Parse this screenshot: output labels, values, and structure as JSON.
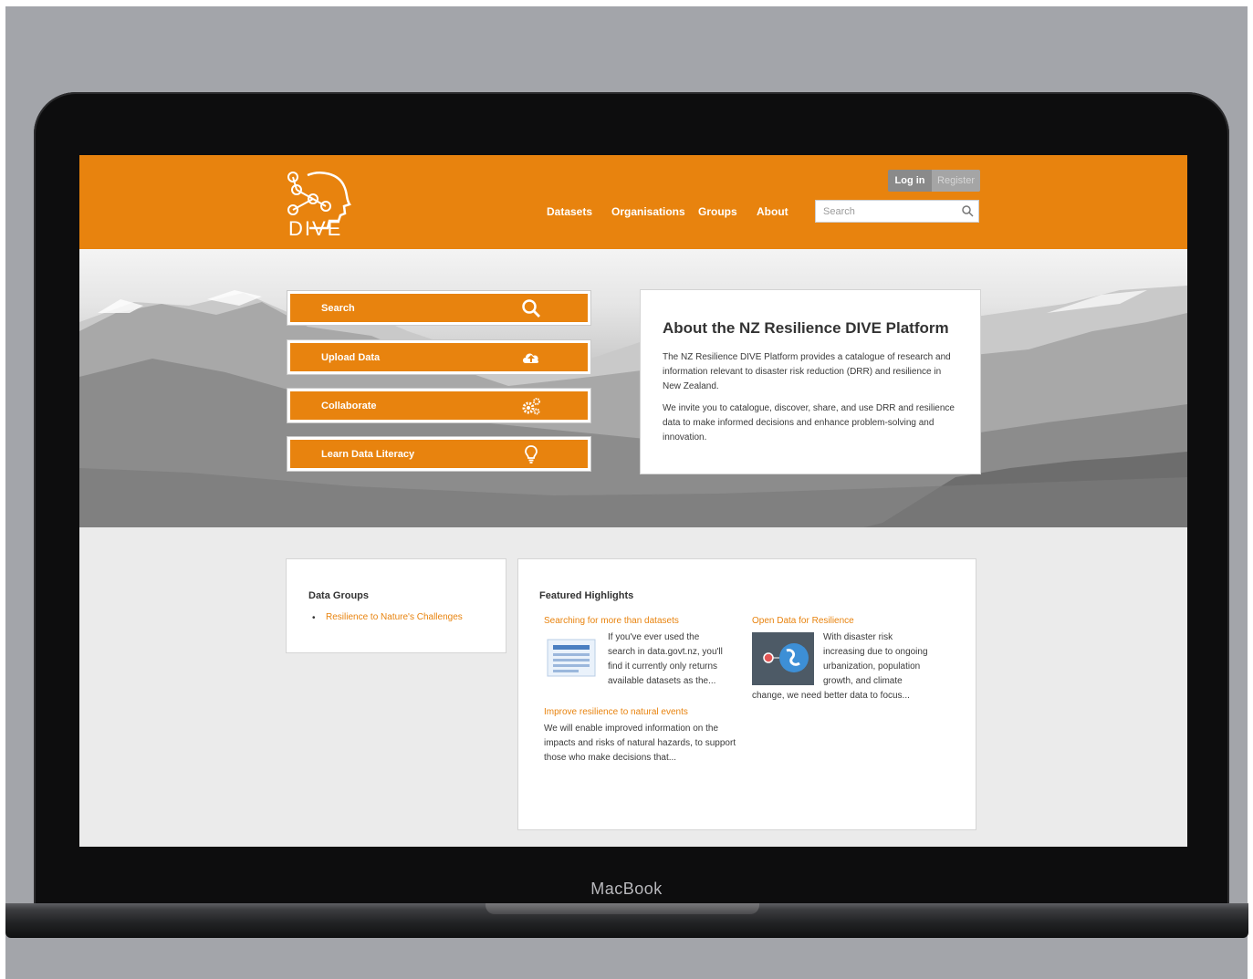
{
  "device": {
    "brand": "MacBook"
  },
  "site": {
    "logo_text": "DIVE",
    "auth": {
      "login": "Log in",
      "register": "Register"
    },
    "nav": [
      {
        "label": "Datasets"
      },
      {
        "label": "Organisations"
      },
      {
        "label": "Groups"
      },
      {
        "label": "About"
      }
    ],
    "search": {
      "placeholder": "Search"
    }
  },
  "hero": {
    "actions": [
      {
        "label": "Search",
        "icon": "search-icon"
      },
      {
        "label": "Upload Data",
        "icon": "cloud-upload-icon"
      },
      {
        "label": "Collaborate",
        "icon": "gears-icon"
      },
      {
        "label": "Learn Data Literacy",
        "icon": "lightbulb-icon"
      }
    ],
    "about": {
      "title": "About the NZ Resilience DIVE Platform",
      "para1": "The NZ Resilience DIVE Platform provides a catalogue of research and information relevant to disaster risk reduction (DRR) and resilience in New Zealand.",
      "para2": "We invite you to catalogue, discover, share, and use DRR and resilience data to make informed decisions and enhance problem-solving and innovation."
    }
  },
  "data_groups": {
    "title": "Data Groups",
    "items": [
      "Resilience to Nature's Challenges"
    ]
  },
  "featured": {
    "title": "Featured Highlights",
    "items": [
      {
        "title": "Searching for more than datasets",
        "text_a": "If you've ever used the",
        "text_b": "search in data.govt.nz, you'll",
        "text_c": "find it currently only returns",
        "text_d": "available datasets as the..."
      },
      {
        "title": "Open Data for Resilience",
        "text_a": "With disaster risk",
        "text_b": "increasing due to ongoing",
        "text_c": "urbanization, population",
        "text_d": "growth, and climate",
        "text_e": "change, we need better data to focus..."
      },
      {
        "title": "Improve resilience to natural events",
        "text": "We will enable improved information on the impacts and risks of natural hazards, to support those who make decisions that..."
      }
    ]
  },
  "colors": {
    "accent": "#e8830e",
    "page_bg": "#ebebeb",
    "frame_bg": "#a3a5aa"
  }
}
